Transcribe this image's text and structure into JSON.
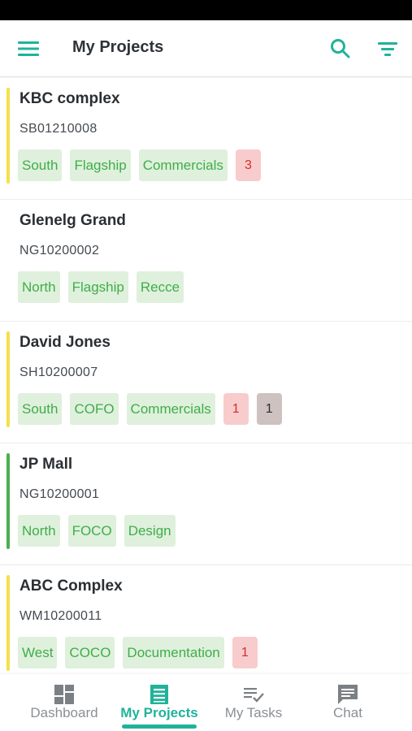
{
  "app_bar": {
    "title": "My Projects",
    "accent_color": "#1fb39a",
    "icons": [
      "menu-icon",
      "search-icon",
      "filter-icon"
    ]
  },
  "projects": [
    {
      "name": "KBC complex",
      "code": "SB01210008",
      "accent": "#f5e04a",
      "tags": [
        "South",
        "Flagship",
        "Commercials"
      ],
      "counts": [
        {
          "value": "3",
          "color": "red"
        }
      ]
    },
    {
      "name": "Glenelg Grand",
      "code": "NG10200002",
      "accent": "",
      "tags": [
        "North",
        "Flagship",
        "Recce"
      ],
      "counts": []
    },
    {
      "name": "David Jones",
      "code": "SH10200007",
      "accent": "#f5e04a",
      "tags": [
        "South",
        "COFO",
        "Commercials"
      ],
      "counts": [
        {
          "value": "1",
          "color": "red"
        },
        {
          "value": "1",
          "color": "grey"
        }
      ]
    },
    {
      "name": "JP Mall",
      "code": "NG10200001",
      "accent": "#4caf50",
      "tags": [
        "North",
        "FOCO",
        "Design"
      ],
      "counts": []
    },
    {
      "name": "ABC Complex",
      "code": "WM10200011",
      "accent": "#f5e04a",
      "tags": [
        "West",
        "COCO",
        "Documentation"
      ],
      "counts": [
        {
          "value": "1",
          "color": "red"
        }
      ]
    }
  ],
  "bottom_nav": [
    {
      "label": "Dashboard",
      "icon": "dashboard-icon",
      "active": false
    },
    {
      "label": "My Projects",
      "icon": "projects-icon",
      "active": true
    },
    {
      "label": "My Tasks",
      "icon": "tasks-icon",
      "active": false
    },
    {
      "label": "Chat",
      "icon": "chat-icon",
      "active": false
    }
  ]
}
